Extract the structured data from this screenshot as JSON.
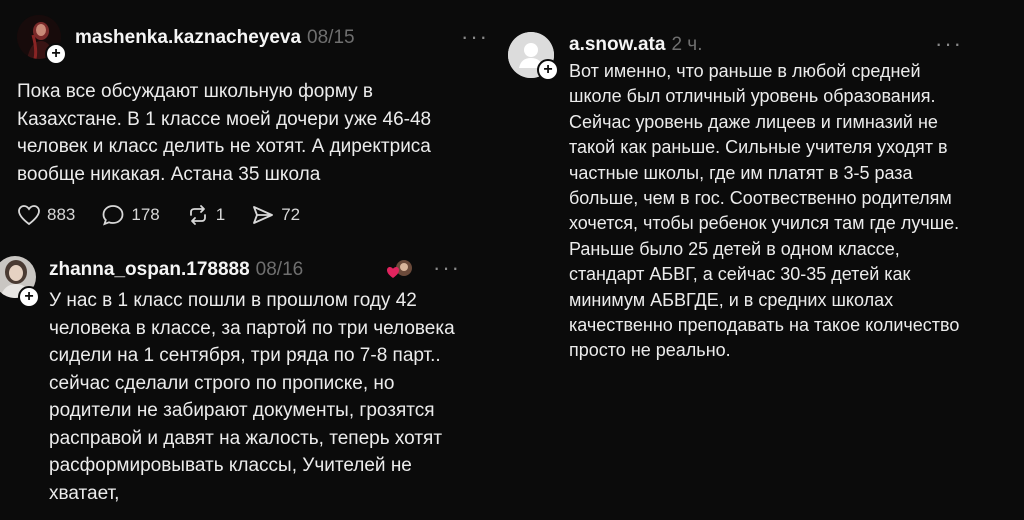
{
  "post1": {
    "username": "mashenka.kaznacheyeva",
    "time": "08/15",
    "text": "Пока все обсуждают школьную форму в Казахстане. В 1 классе моей дочери уже 46-48 человек и класс делить не хотят. А директриса вообще никакая. Астана 35 школа",
    "likes": "883",
    "comments": "178",
    "reposts": "1",
    "shares": "72",
    "follow_icon": "+",
    "more_icon": "···"
  },
  "post2": {
    "username": "zhanna_ospan.178888",
    "time": "08/16",
    "text": "У нас в 1 класс пошли в прошлом году 42 человека в классе, за партой по три человека сидели на 1 сентября, три ряда по 7-8 парт.. сейчас сделали строго по прописке, но родители не забирают документы, грозятся расправой и давят на жалость, теперь хотят расформировывать классы, Учителей не хватает,",
    "follow_icon": "+",
    "more_icon": "···",
    "liked_by_author_icon": "heart-avatar-icon"
  },
  "post3": {
    "username": "a.snow.ata",
    "time": "2 ч.",
    "text": "Вот именно, что раньше в любой средней школе был отличный уровень образования. Сейчас уровень даже лицеев и гимназий не такой как раньше. Сильные учителя уходят в частные школы, где им платят в 3-5 раза больше, чем в гос. Соотвественно родителям хочется, чтобы ребенок учился там где лучше. Раньше было 25 детей в одном классе, стандарт АБВГ, а сейчас 30-35 детей как минимум АБВГДЕ, и в средних школах качественно преподавать на такое количество просто не реально.",
    "follow_icon": "+",
    "more_icon": "···"
  },
  "colors": {
    "background": "#0b0b0b",
    "text": "#ececec",
    "muted": "#6f6f6f",
    "heart": "#e0245e"
  }
}
